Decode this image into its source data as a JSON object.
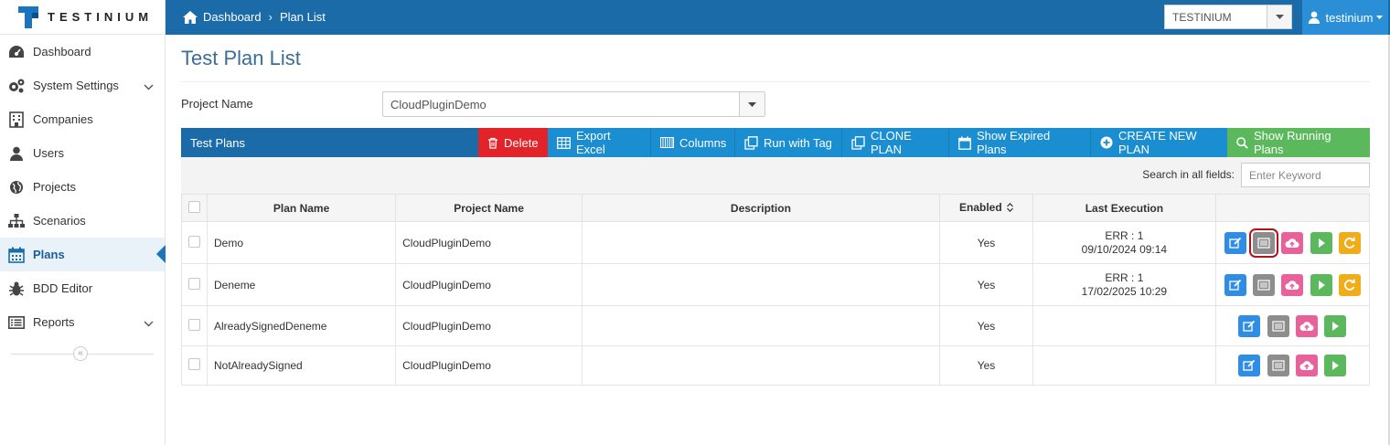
{
  "app": {
    "logo_text": "TESTINIUM"
  },
  "breadcrumb": {
    "home": "Dashboard",
    "current": "Plan List"
  },
  "org_select": {
    "value": "TESTINIUM"
  },
  "user": {
    "name": "testinium"
  },
  "sidebar": {
    "items": [
      {
        "label": "Dashboard",
        "icon": "dashboard-icon"
      },
      {
        "label": "System Settings",
        "icon": "gears-icon",
        "expandable": true
      },
      {
        "label": "Companies",
        "icon": "building-icon"
      },
      {
        "label": "Users",
        "icon": "user-icon"
      },
      {
        "label": "Projects",
        "icon": "globe-icon"
      },
      {
        "label": "Scenarios",
        "icon": "sitemap-icon"
      },
      {
        "label": "Plans",
        "icon": "calendar-icon",
        "active": true
      },
      {
        "label": "BDD Editor",
        "icon": "bug-icon"
      },
      {
        "label": "Reports",
        "icon": "list-icon",
        "expandable": true
      }
    ],
    "collapse_glyph": "«"
  },
  "page": {
    "title": "Test Plan List"
  },
  "project": {
    "label": "Project Name",
    "value": "CloudPluginDemo"
  },
  "toolbar": {
    "title": "Test Plans",
    "delete": "Delete",
    "export": "Export Excel",
    "columns": "Columns",
    "run_tag": "Run with Tag",
    "clone": "CLONE PLAN",
    "expired": "Show Expired Plans",
    "create": "CREATE NEW PLAN",
    "running": "Show Running Plans"
  },
  "search": {
    "label": "Search in all fields:",
    "placeholder": "Enter Keyword"
  },
  "table": {
    "headers": {
      "plan_name": "Plan Name",
      "project_name": "Project Name",
      "description": "Description",
      "enabled": "Enabled",
      "last_execution": "Last Execution"
    },
    "rows": [
      {
        "plan_name": "Demo",
        "project_name": "CloudPluginDemo",
        "description": "",
        "enabled": "Yes",
        "exec_status": "ERR : 1",
        "exec_date": "09/10/2024 09:14"
      },
      {
        "plan_name": "Deneme",
        "project_name": "CloudPluginDemo",
        "description": "",
        "enabled": "Yes",
        "exec_status": "ERR : 1",
        "exec_date": "17/02/2025 10:29"
      },
      {
        "plan_name": "AlreadySignedDeneme",
        "project_name": "CloudPluginDemo",
        "description": "",
        "enabled": "Yes",
        "exec_status": "",
        "exec_date": ""
      },
      {
        "plan_name": "NotAlreadySigned",
        "project_name": "CloudPluginDemo",
        "description": "",
        "enabled": "Yes",
        "exec_status": "",
        "exec_date": ""
      }
    ]
  },
  "colors": {
    "primary": "#1b6ba9",
    "toolbar_btn": "#1b8ed1",
    "delete": "#e3232a",
    "success": "#5cb85c",
    "title": "#3a6d99"
  }
}
